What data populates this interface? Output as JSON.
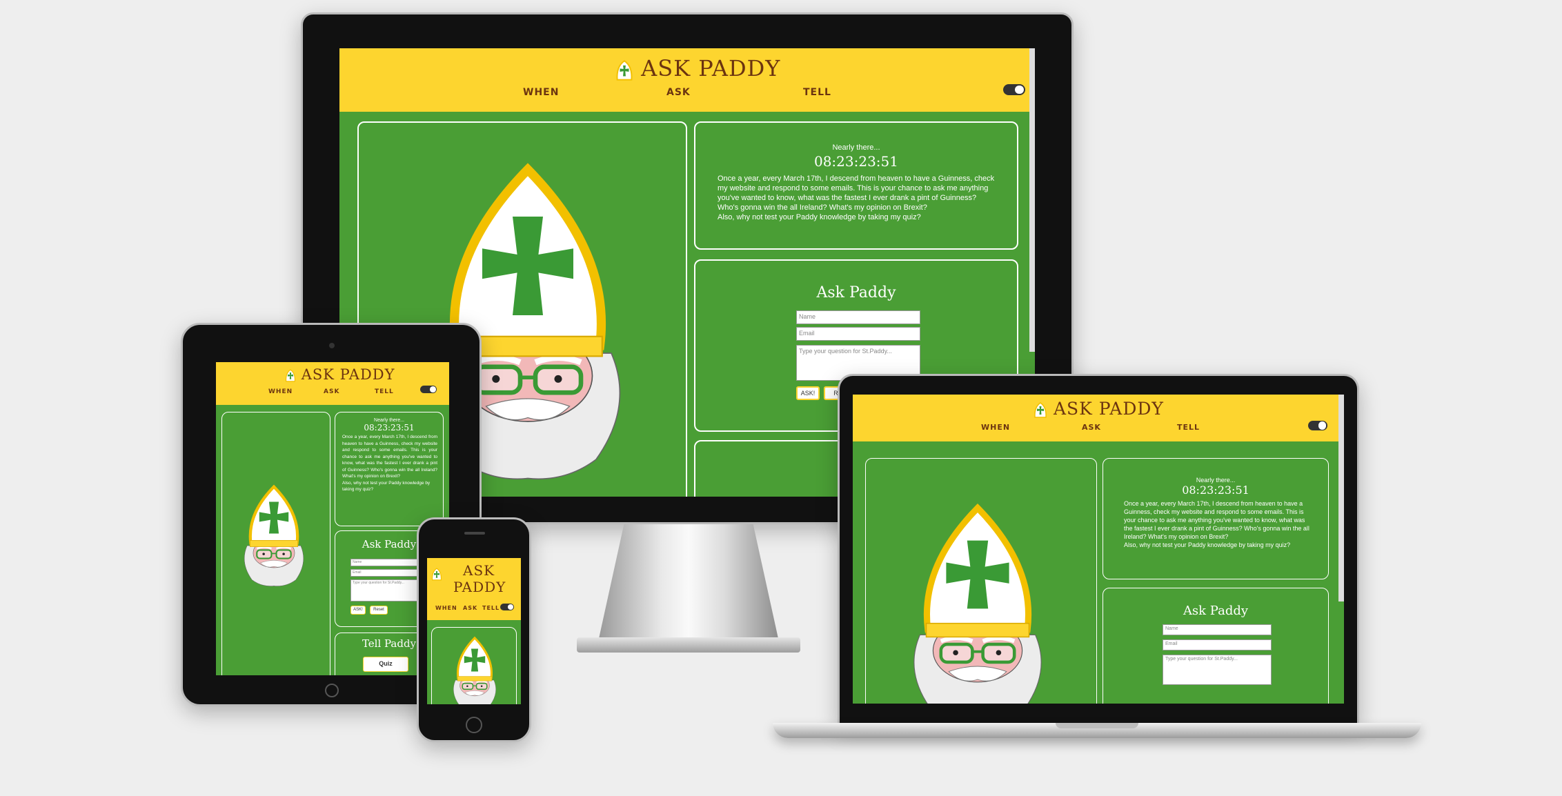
{
  "site": {
    "brand": "ASK PADDY",
    "nav": [
      "WHEN",
      "ASK",
      "TELL"
    ],
    "countdown_label": "Nearly there...",
    "countdown": "08:23:23:51",
    "intro": "Once a year, every March 17th, I descend from heaven to have a Guinness, check my website and respond to some emails. This is your chance to ask me anything you've wanted to know, what was the fastest I ever drank a pint of Guinness? Who's gonna win the all Ireland? What's my opinion on Brexit?",
    "intro_quiz": "Also, why not test your Paddy knowledge by taking my quiz?",
    "ask_title": "Ask Paddy",
    "name_placeholder": "Name",
    "email_placeholder": "Email",
    "question_placeholder": "Type your question for St.Paddy...",
    "ask_button": "ASK!",
    "reset_button": "Reset",
    "reset_button_partial": "Re",
    "tell_title": "Tell Paddy",
    "tell_title_partial": "Tel",
    "quiz_button": "Quiz",
    "phone_brand_line1": "ASK",
    "phone_brand_line2": "PADDY"
  },
  "colors": {
    "header": "#fdd52f",
    "body": "#4a9e35",
    "brand_text": "#6b3410",
    "panel_border": "#ffffff"
  },
  "icons": [
    "shamrock-cross-logo-icon",
    "toggle-switch-icon",
    "st-patrick-bishop-illustration"
  ]
}
